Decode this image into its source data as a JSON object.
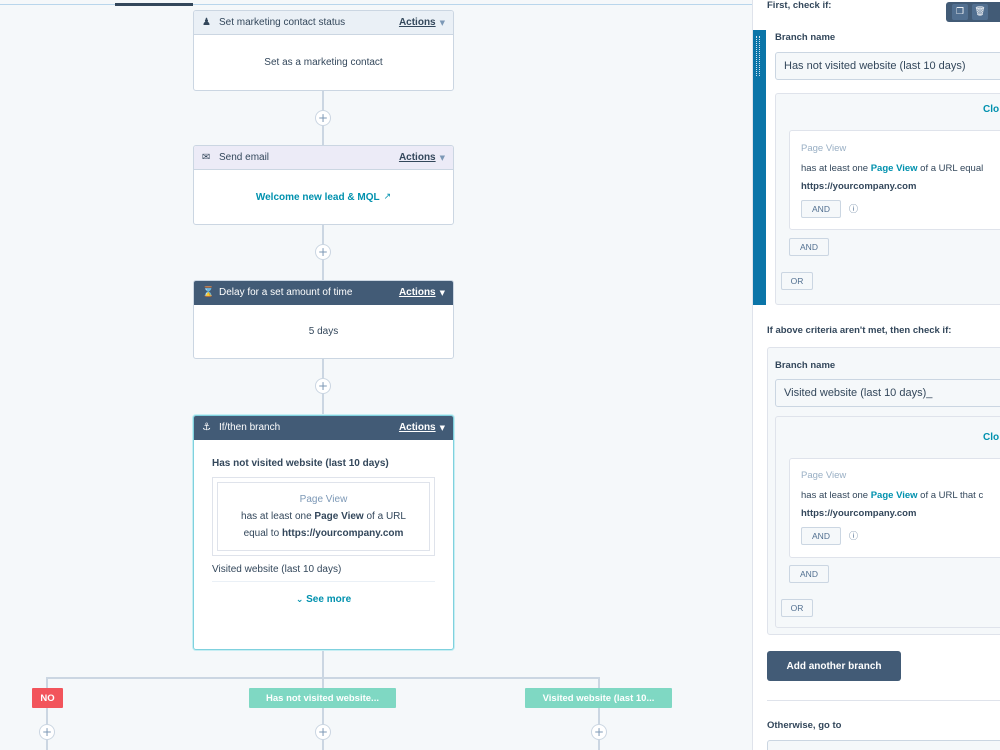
{
  "workflow": {
    "cards": [
      {
        "title": "Set marketing contact status",
        "actions_label": "Actions",
        "body": "Set as a marketing contact",
        "icon": "person-icon"
      },
      {
        "title": "Send email",
        "actions_label": "Actions",
        "body": "Welcome new lead & MQL",
        "icon": "email-icon"
      },
      {
        "title": "Delay for a set amount of time",
        "actions_label": "Actions",
        "body": "5 days",
        "icon": "hourglass-icon"
      }
    ],
    "branch": {
      "title": "If/then branch",
      "actions_label": "Actions",
      "branch1_name": "Has not visited website (last 10 days)",
      "filter_title": "Page View",
      "filter_line1_a": "has at least one ",
      "filter_line1_b": "Page View",
      "filter_line1_c": " of a URL",
      "filter_line2_a": "equal to ",
      "filter_line2_b": "https://yourcompany.com",
      "branch2_name": "Visited website (last 10 days)",
      "see_more": "See more"
    },
    "plus_label": "+",
    "tags": [
      {
        "label": "NO",
        "color": "#f2545b"
      },
      {
        "label": "Has not visited website...",
        "color": "#7fd8c3"
      },
      {
        "label": "Visited website (last 10...",
        "color": "#7fd8c3"
      }
    ]
  },
  "panel": {
    "first_check": "First, check if:",
    "branch_name_label": "Branch name",
    "branch1": {
      "name_value": "Has not visited website (last 10 days)",
      "clone": "Clo",
      "filter_title": "Page View",
      "line_a": "has at least one ",
      "line_b": "Page View",
      "line_c": " of a URL equal",
      "url": "https://yourcompany.com"
    },
    "and_label": "AND",
    "or_label": "OR",
    "else_check": "If above criteria aren't met, then check if:",
    "branch2": {
      "name_value": "Visited website (last 10 days)_",
      "clone": "Clo",
      "filter_title": "Page View",
      "line_a": "has at least one ",
      "line_b": "Page View",
      "line_c": " of a URL that c",
      "url": "https://yourcompany.com"
    },
    "add_branch": "Add another branch",
    "otherwise": "Otherwise, go to"
  }
}
